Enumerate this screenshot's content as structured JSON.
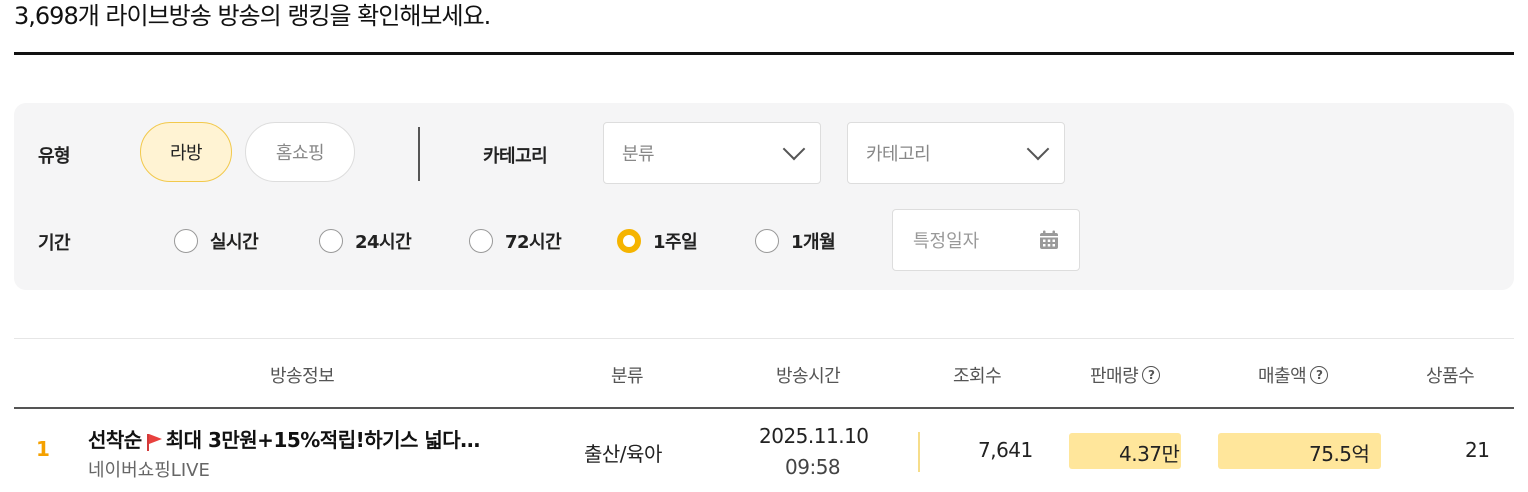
{
  "header": {
    "headline": "3,698개 라이브방송 방송의 랭킹을 확인해보세요."
  },
  "filters": {
    "type_label": "유형",
    "type_options": [
      "라방",
      "홈쇼핑"
    ],
    "type_selected": "라방",
    "category_label": "카테고리",
    "classification_select": "분류",
    "category_select": "카테고리",
    "period_label": "기간",
    "period_options": [
      "실시간",
      "24시간",
      "72시간",
      "1주일",
      "1개월"
    ],
    "period_selected": "1주일",
    "date_placeholder": "특정일자"
  },
  "table": {
    "columns": [
      "방송정보",
      "분류",
      "방송시간",
      "조회수",
      "판매량",
      "매출액",
      "상품수"
    ],
    "rows": [
      {
        "rank": "1",
        "title_prefix": "선착순",
        "title_rest": "최대 3만원+15%적립!하기스 넓다…",
        "channel": "네이버쇼핑LIVE",
        "category": "출산/육아",
        "date": "2025.11.10",
        "time": "09:58",
        "views": "7,641",
        "sales": "4.37만",
        "revenue": "75.5억",
        "products": "21"
      }
    ]
  },
  "colors": {
    "accent": "#f5b400",
    "rank": "#f5a100",
    "highlight": "#ffe69b",
    "active_pill_bg": "#fff3d3",
    "filter_bg": "#f5f5f6"
  }
}
